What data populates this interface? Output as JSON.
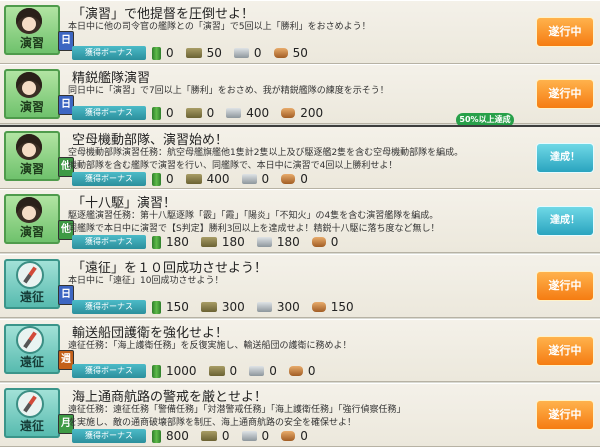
{
  "quests": [
    {
      "category": "演習",
      "frequency": "日",
      "title": "「演習」で他提督を圧倒せよ！",
      "desc": [
        "本日中に他の司令官の艦隊との「演習」で5回以上「勝利」をおさめよう！"
      ],
      "bonus_label": "獲得ボーナス",
      "rewards": {
        "fuel": "0",
        "ammo": "50",
        "steel": "0",
        "bauxite": "50"
      },
      "status": "遂行中",
      "status_type": "active"
    },
    {
      "category": "演習",
      "frequency": "日",
      "title": "精鋭艦隊演習",
      "desc": [
        "同日中に「演習」で7回以上「勝利」をおさめ、我が精鋭艦隊の練度を示そう！"
      ],
      "bonus_label": "獲得ボーナス",
      "rewards": {
        "fuel": "0",
        "ammo": "0",
        "steel": "400",
        "bauxite": "200"
      },
      "status": "遂行中",
      "status_type": "active",
      "progress": "50%以上達成"
    },
    {
      "category": "演習",
      "frequency": "他",
      "title": "空母機動部隊、演習始め！",
      "desc": [
        "空母機動部隊演習任務：航空母艦旗艦他1隻計2隻以上及び駆逐艦2隻を含む空母機動部隊を編成。",
        "機動部隊を含む艦隊で演習を行い、同艦隊で、本日中に演習で4回以上勝利せよ！"
      ],
      "bonus_label": "獲得ボーナス",
      "rewards": {
        "fuel": "0",
        "ammo": "400",
        "steel": "0",
        "bauxite": "0"
      },
      "status": "達成！",
      "status_type": "done"
    },
    {
      "category": "演習",
      "frequency": "他",
      "title": "「十八駆」演習！",
      "desc": [
        "駆逐艦演習任務：第十八駆逐隊「霰」「霞」「陽炎」「不知火」の4隻を含む演習艦隊を編成。",
        "同艦隊で本日中に演習で【S判定】勝利3回以上を達成せよ！精鋭十八駆に落ち度など無し！"
      ],
      "bonus_label": "獲得ボーナス",
      "rewards": {
        "fuel": "180",
        "ammo": "180",
        "steel": "180",
        "bauxite": "0"
      },
      "status": "達成！",
      "status_type": "done"
    },
    {
      "category": "遠征",
      "frequency": "日",
      "title": "「遠征」を１０回成功させよう！",
      "desc": [
        "本日中に「遠征」10回成功させよう！"
      ],
      "bonus_label": "獲得ボーナス",
      "rewards": {
        "fuel": "150",
        "ammo": "300",
        "steel": "300",
        "bauxite": "150"
      },
      "status": "遂行中",
      "status_type": "active"
    },
    {
      "category": "遠征",
      "frequency": "週",
      "title": "輸送船団護衛を強化せよ！",
      "desc": [
        "遠征任務：「海上護衛任務」を反復実施し、輸送船団の護衛に務めよ！"
      ],
      "bonus_label": "獲得ボーナス",
      "rewards": {
        "fuel": "1000",
        "ammo": "0",
        "steel": "0",
        "bauxite": "0"
      },
      "status": "遂行中",
      "status_type": "active"
    },
    {
      "category": "遠征",
      "frequency": "月",
      "title": "海上通商航路の警戒を厳とせよ！",
      "desc": [
        "遠征任務：遠征任務「警備任務」「対潜警戒任務」「海上護衛任務」「強行偵察任務」",
        "を実施し、敵の通商破壊部隊を制圧、海上通商航路の安全を確保せよ！"
      ],
      "bonus_label": "獲得ボーナス",
      "rewards": {
        "fuel": "800",
        "ammo": "0",
        "steel": "0",
        "bauxite": "0"
      },
      "status": "遂行中",
      "status_type": "active"
    }
  ]
}
